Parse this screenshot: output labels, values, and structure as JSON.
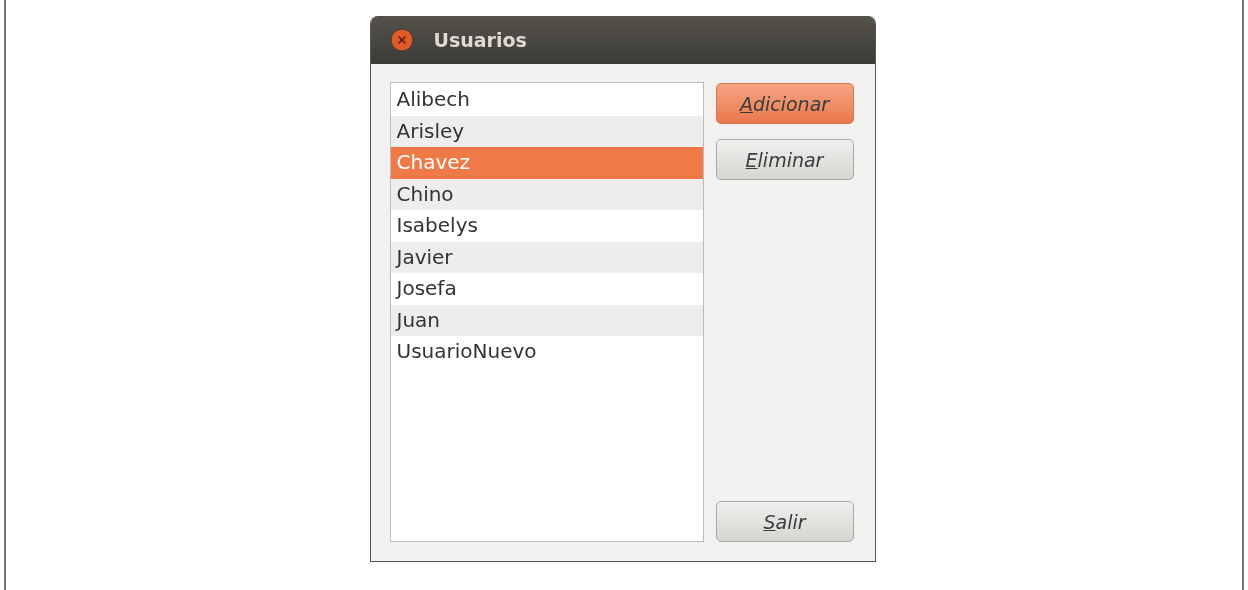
{
  "window": {
    "title": "Usuarios"
  },
  "users": [
    {
      "name": "Alibech",
      "selected": false
    },
    {
      "name": "Arisley",
      "selected": false
    },
    {
      "name": "Chavez",
      "selected": true
    },
    {
      "name": "Chino",
      "selected": false
    },
    {
      "name": "Isabelys",
      "selected": false
    },
    {
      "name": "Javier",
      "selected": false
    },
    {
      "name": "Josefa",
      "selected": false
    },
    {
      "name": "Juan",
      "selected": false
    },
    {
      "name": "UsuarioNuevo",
      "selected": false
    }
  ],
  "buttons": [
    {
      "label": "Adicionar",
      "highlighted": true
    },
    {
      "label": "Eliminar",
      "highlighted": false
    },
    {
      "label": "Salir",
      "highlighted": false
    }
  ]
}
